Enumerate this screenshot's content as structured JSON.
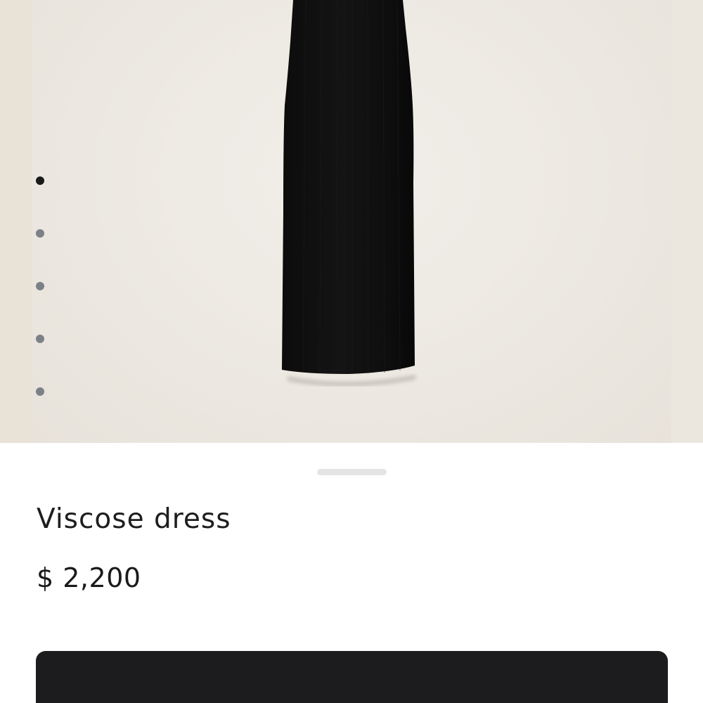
{
  "product": {
    "name": "Viscose dress",
    "price": "$ 2,200"
  },
  "gallery": {
    "image": "black-dress-photo",
    "dots": [
      {
        "active": true
      },
      {
        "active": false
      },
      {
        "active": false
      },
      {
        "active": false
      },
      {
        "active": false
      }
    ]
  },
  "sheet": {
    "handle": "drag-handle"
  },
  "cta": {
    "label": ""
  },
  "colors": {
    "background": "#ece8e1",
    "dot_active": "#1a1a1a",
    "dot_inactive": "#7c8188",
    "cta_bg": "#1c1c1e",
    "text": "#1e1e1e"
  }
}
